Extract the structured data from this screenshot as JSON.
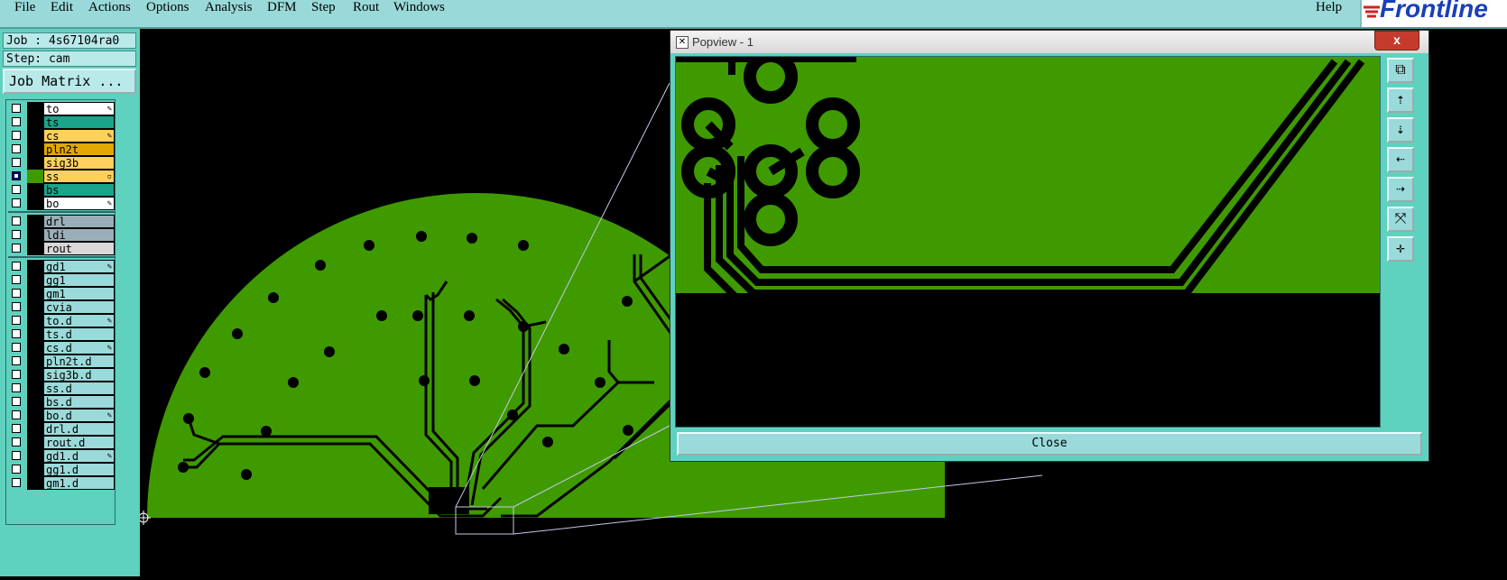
{
  "menubar": {
    "items": [
      "File",
      "Edit",
      "Actions",
      "Options",
      "Analysis",
      "DFM",
      "Step",
      "Rout",
      "Windows"
    ],
    "help": "Help",
    "logo": "Frontline"
  },
  "leftpanel": {
    "job": "Job : 4s67104ra0",
    "step": "Step: cam",
    "job_matrix": "Job Matrix ...",
    "layers": [
      {
        "name": "to",
        "color": "#ffffff",
        "flag": "✎"
      },
      {
        "name": "ts",
        "color": "#1aa58a",
        "flag": ""
      },
      {
        "name": "cs",
        "color": "#ffd060",
        "flag": "✎"
      },
      {
        "name": "pln2t",
        "color": "#e0a800",
        "flag": ""
      },
      {
        "name": "sig3b",
        "color": "#ffd060",
        "flag": ""
      },
      {
        "name": "ss",
        "color": "#ffd060",
        "flag": "▫",
        "checked": true
      },
      {
        "name": "bs",
        "color": "#1aa58a",
        "flag": ""
      },
      {
        "name": "bo",
        "color": "#ffffff",
        "flag": "✎"
      },
      {
        "name": "drl",
        "color": "#9aaeb8",
        "flag": ""
      },
      {
        "name": "ldi",
        "color": "#9aaeb8",
        "flag": ""
      },
      {
        "name": "rout",
        "color": "#d8d8d8",
        "flag": ""
      },
      {
        "name": "gd1",
        "color": "#9adada",
        "flag": "✎"
      },
      {
        "name": "gg1",
        "color": "#9adada",
        "flag": ""
      },
      {
        "name": "gm1",
        "color": "#9adada",
        "flag": ""
      },
      {
        "name": "cvia",
        "color": "#9adada",
        "flag": ""
      },
      {
        "name": "to.d",
        "color": "#9adada",
        "flag": "✎"
      },
      {
        "name": "ts.d",
        "color": "#9adada",
        "flag": ""
      },
      {
        "name": "cs.d",
        "color": "#9adada",
        "flag": "✎"
      },
      {
        "name": "pln2t.d",
        "color": "#9adada",
        "flag": ""
      },
      {
        "name": "sig3b.d",
        "color": "#9adada",
        "flag": ""
      },
      {
        "name": "ss.d",
        "color": "#9adada",
        "flag": ""
      },
      {
        "name": "bs.d",
        "color": "#9adada",
        "flag": ""
      },
      {
        "name": "bo.d",
        "color": "#9adada",
        "flag": "✎"
      },
      {
        "name": "drl.d",
        "color": "#9adada",
        "flag": ""
      },
      {
        "name": "rout.d",
        "color": "#9adada",
        "flag": ""
      },
      {
        "name": "gd1.d",
        "color": "#9adada",
        "flag": "✎"
      },
      {
        "name": "gg1.d",
        "color": "#9adada",
        "flag": ""
      },
      {
        "name": "gm1.d",
        "color": "#9adada",
        "flag": ""
      }
    ]
  },
  "popview": {
    "title": "Popview - 1",
    "close_x": "x",
    "close_button": "Close",
    "tools": [
      "zoom-window-icon",
      "pan-up-icon",
      "pan-down-icon",
      "pan-left-icon",
      "pan-right-icon",
      "zoom-fit-icon",
      "zoom-center-icon"
    ]
  },
  "colors": {
    "board": "#3f9a00",
    "trace": "#000000",
    "panel": "#5fd1bf",
    "menubar": "#9ad9d9"
  }
}
